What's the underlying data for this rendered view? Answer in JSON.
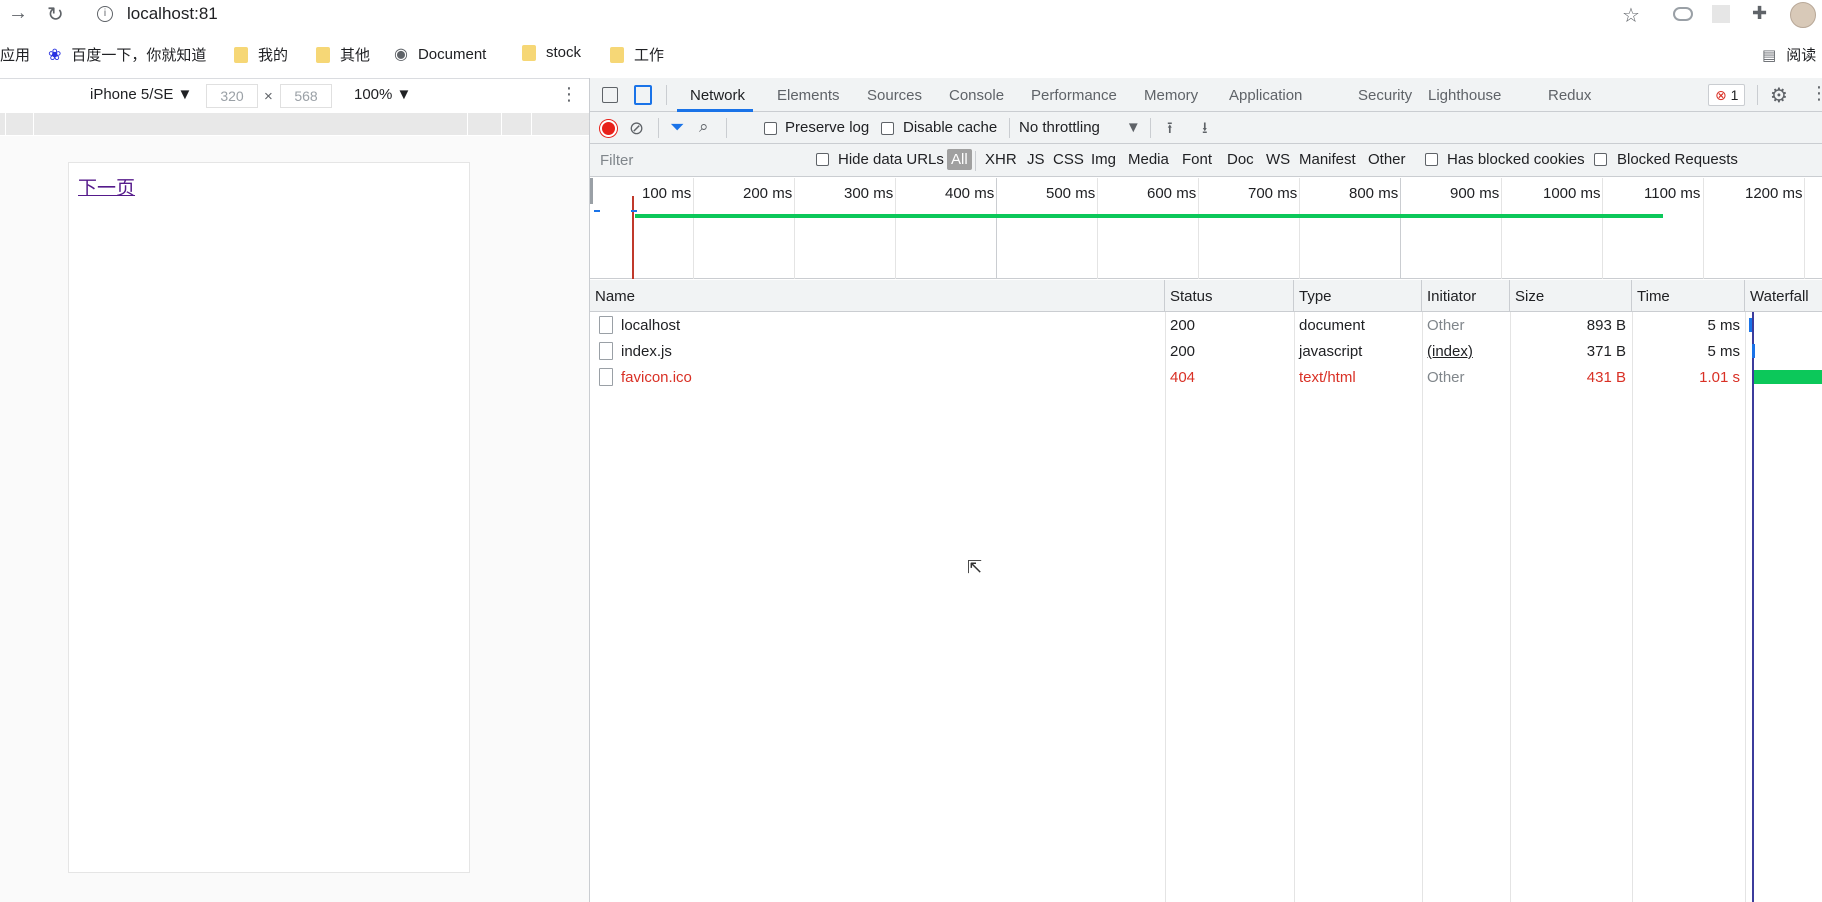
{
  "browser": {
    "url": "localhost:81",
    "bookmarks": [
      "应用",
      "百度一下，你就知道",
      "我的",
      "其他",
      "Document",
      "stock",
      "工作"
    ],
    "reading_list": "阅读"
  },
  "device_toolbar": {
    "device": "iPhone 5/SE ▼",
    "width": "320",
    "times": "×",
    "height": "568",
    "zoom": "100% ▼"
  },
  "page": {
    "link": "下一页"
  },
  "devtools": {
    "tabs": [
      "Network",
      "Elements",
      "Sources",
      "Console",
      "Performance",
      "Memory",
      "Application",
      "Security",
      "Lighthouse",
      "Redux"
    ],
    "error_count": "1",
    "toolbar": {
      "preserve_log": "Preserve log",
      "disable_cache": "Disable cache",
      "throttling": "No throttling"
    },
    "filter": {
      "placeholder": "Filter",
      "hide_data_urls": "Hide data URLs",
      "types": [
        "All",
        "XHR",
        "JS",
        "CSS",
        "Img",
        "Media",
        "Font",
        "Doc",
        "WS",
        "Manifest",
        "Other"
      ],
      "has_blocked_cookies": "Has blocked cookies",
      "blocked_requests": "Blocked Requests"
    },
    "overview_labels": [
      "100 ms",
      "200 ms",
      "300 ms",
      "400 ms",
      "500 ms",
      "600 ms",
      "700 ms",
      "800 ms",
      "900 ms",
      "1000 ms",
      "1100 ms",
      "1200 ms"
    ],
    "columns": [
      "Name",
      "Status",
      "Type",
      "Initiator",
      "Size",
      "Time",
      "Waterfall"
    ],
    "rows": [
      {
        "name": "localhost",
        "status": "200",
        "type": "document",
        "initiator": "Other",
        "size": "893 B",
        "time": "5 ms",
        "error": false
      },
      {
        "name": "index.js",
        "status": "200",
        "type": "javascript",
        "initiator": "(index)",
        "size": "371 B",
        "time": "5 ms",
        "error": false
      },
      {
        "name": "favicon.ico",
        "status": "404",
        "type": "text/html",
        "initiator": "Other",
        "size": "431 B",
        "time": "1.01 s",
        "error": true
      }
    ]
  },
  "colors": {
    "accent": "#1a73e8",
    "error": "#d93025",
    "waterfall_green": "#0cc85a",
    "record": "#e8211a"
  }
}
